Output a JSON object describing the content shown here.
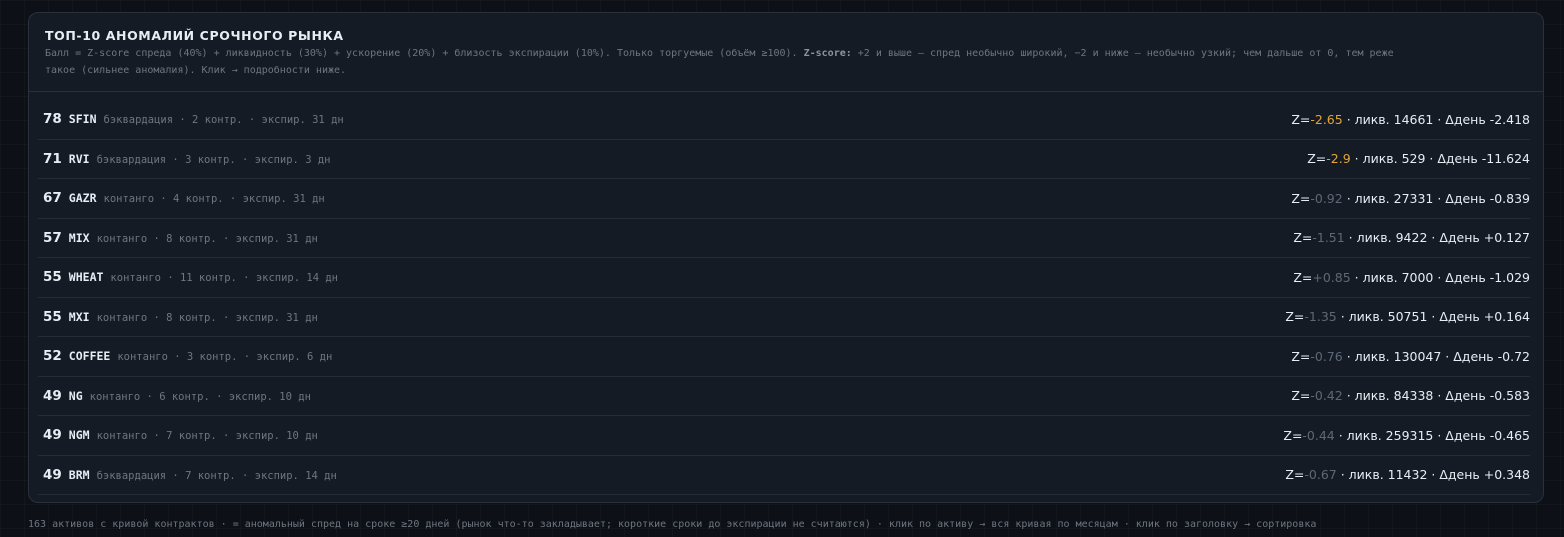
{
  "panel": {
    "title": "ТОП-10 АНОМАЛИЙ СРОЧНОГО РЫНКА",
    "desc_part1": "Балл = Z-score спреда (40%) + ликвидность (30%) + ускорение (20%) + близость экспирации (10%). Только торгуемые (объём ≥100). ",
    "desc_bold": "Z-score:",
    "desc_part2": " +2 и выше — спред необычно широкий, −2 и ниже — необычно узкий; чем дальше от 0, тем реже",
    "desc_line2": "такое (сильнее аномалия). Клик → подробности ниже."
  },
  "rows": [
    {
      "score": "78",
      "ticker": "SFIN",
      "meta": "бэквардация · 2 контр. · экспир. 31 дн",
      "z_prefix": "Z=",
      "z": "-2.65",
      "z_state": "hot",
      "rest": " · ликв. 14661 · Δдень -2.418"
    },
    {
      "score": "71",
      "ticker": "RVI",
      "meta": "бэквардация · 3 контр. · экспир. 3 дн",
      "z_prefix": "Z=",
      "z": "-2.9",
      "z_state": "hot",
      "rest": " · ликв. 529 · Δдень -11.624"
    },
    {
      "score": "67",
      "ticker": "GAZR",
      "meta": "контанго · 4 контр. · экспир. 31 дн",
      "z_prefix": "Z=",
      "z": "-0.92",
      "z_state": "cold",
      "rest": " · ликв. 27331 · Δдень -0.839"
    },
    {
      "score": "57",
      "ticker": "MIX",
      "meta": "контанго · 8 контр. · экспир. 31 дн",
      "z_prefix": "Z=",
      "z": "-1.51",
      "z_state": "cold",
      "rest": " · ликв. 9422 · Δдень +0.127"
    },
    {
      "score": "55",
      "ticker": "WHEAT",
      "meta": "контанго · 11 контр. · экспир. 14 дн",
      "z_prefix": "Z=",
      "z": "+0.85",
      "z_state": "cold",
      "rest": " · ликв. 7000 · Δдень -1.029"
    },
    {
      "score": "55",
      "ticker": "MXI",
      "meta": "контанго · 8 контр. · экспир. 31 дн",
      "z_prefix": "Z=",
      "z": "-1.35",
      "z_state": "cold",
      "rest": " · ликв. 50751 · Δдень +0.164"
    },
    {
      "score": "52",
      "ticker": "COFFEE",
      "meta": "контанго · 3 контр. · экспир. 6 дн",
      "z_prefix": "Z=",
      "z": "-0.76",
      "z_state": "cold",
      "rest": " · ликв. 130047 · Δдень -0.72"
    },
    {
      "score": "49",
      "ticker": "NG",
      "meta": "контанго · 6 контр. · экспир. 10 дн",
      "z_prefix": "Z=",
      "z": "-0.42",
      "z_state": "cold",
      "rest": " · ликв. 84338 · Δдень -0.583"
    },
    {
      "score": "49",
      "ticker": "NGM",
      "meta": "контанго · 7 контр. · экспир. 10 дн",
      "z_prefix": "Z=",
      "z": "-0.44",
      "z_state": "cold",
      "rest": " · ликв. 259315 · Δдень -0.465"
    },
    {
      "score": "49",
      "ticker": "BRM",
      "meta": "бэквардация · 7 контр. · экспир. 14 дн",
      "z_prefix": "Z=",
      "z": "-0.67",
      "z_state": "cold",
      "rest": " · ликв. 11432 · Δдень +0.348"
    }
  ],
  "footer": {
    "text": "163 активов с кривой контрактов · = аномальный спред на сроке ≥20 дней (рынок что-то закладывает; короткие сроки до экспирации не считаются) · клик по активу → вся кривая по месяцам · клик по заголовку → сортировка"
  },
  "colors": {
    "z_hot": "#e3a53a",
    "z_cold": "#5d6876"
  }
}
